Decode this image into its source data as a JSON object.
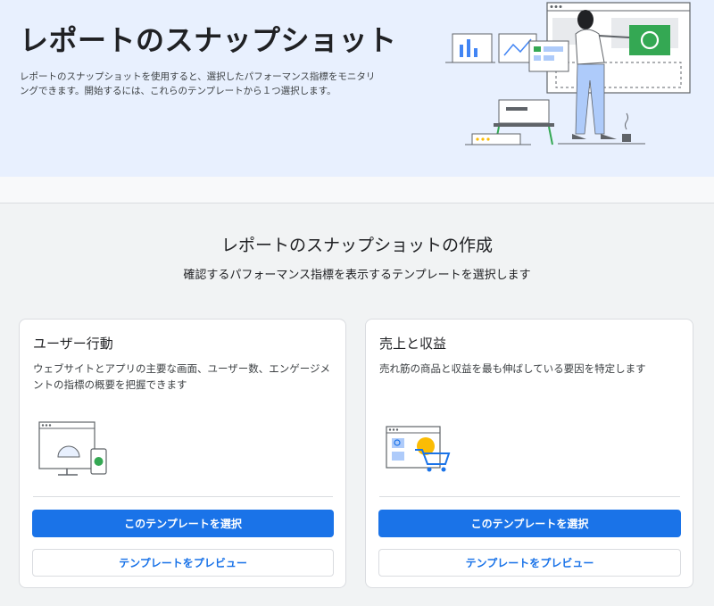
{
  "hero": {
    "title": "レポートのスナップショット",
    "description": "レポートのスナップショットを使用すると、選択したパフォーマンス指標をモニタリングできます。開始するには、これらのテンプレートから１つ選択します。"
  },
  "section": {
    "title": "レポートのスナップショットの作成",
    "subtitle": "確認するパフォーマンス指標を表示するテンプレートを選択します"
  },
  "cards": [
    {
      "title": "ユーザー行動",
      "description": "ウェブサイトとアプリの主要な画面、ユーザー数、エンゲージメントの指標の概要を把握できます",
      "select_label": "このテンプレートを選択",
      "preview_label": "テンプレートをプレビュー"
    },
    {
      "title": "売上と収益",
      "description": "売れ筋の商品と収益を最も伸ばしている要因を特定します",
      "select_label": "このテンプレートを選択",
      "preview_label": "テンプレートをプレビュー"
    }
  ],
  "colors": {
    "accent": "#1a73e8",
    "hero_bg": "#e8f0fe",
    "page_bg": "#f1f3f4",
    "green": "#34a853",
    "yellow": "#fbbc04"
  }
}
